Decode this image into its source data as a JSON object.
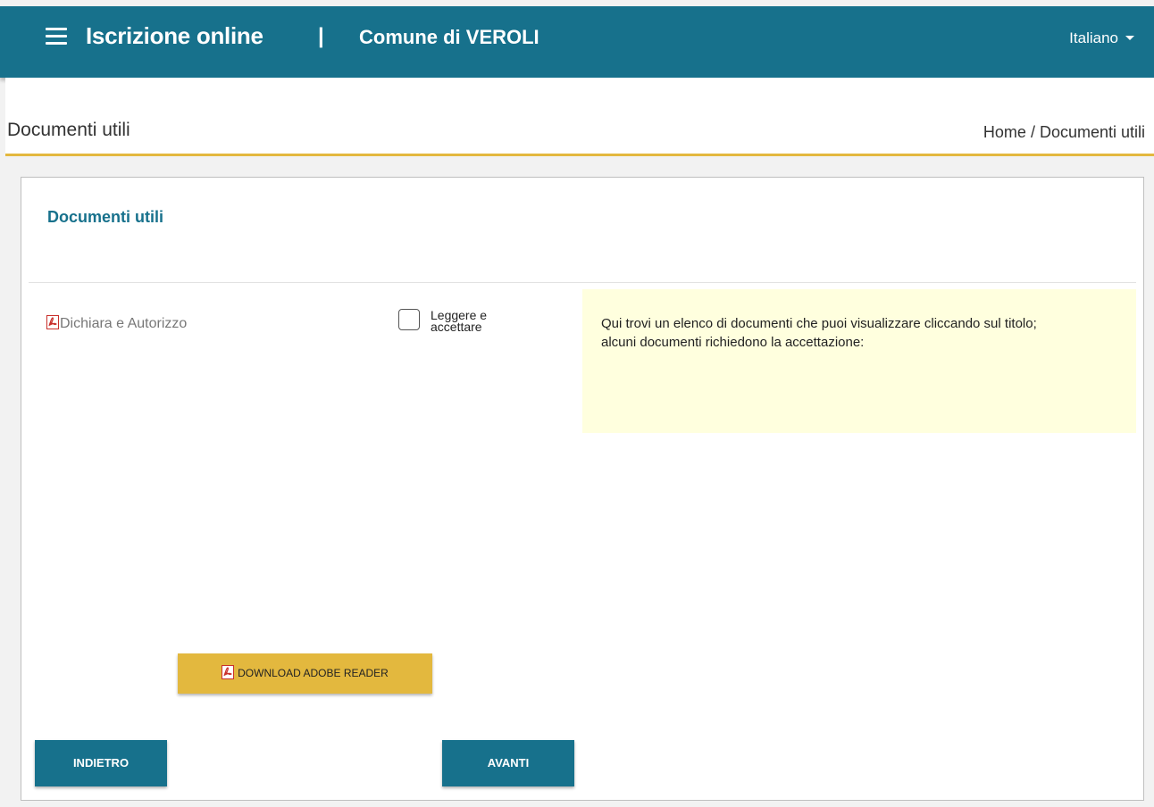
{
  "header": {
    "app_title": "Iscrizione online",
    "separator": "|",
    "comune": "Comune di VEROLI",
    "language": "Italiano",
    "bg_color": "#17718c"
  },
  "page": {
    "title": "Documenti utili",
    "breadcrumb_home": "Home",
    "breadcrumb_sep": " / ",
    "breadcrumb_current": "Documenti utili",
    "accent_color": "#e3b83e"
  },
  "card": {
    "title": "Documenti utili",
    "documents": [
      {
        "icon": "pdf-icon",
        "label": "Dichiara e Autorizzo",
        "accept_label": "Leggere e accettare",
        "accepted": false
      }
    ],
    "info_lines": [
      "Qui trovi un elenco di documenti che puoi visualizzare cliccando sul titolo;",
      "alcuni documenti richiedono la accettazione:"
    ],
    "adobe_button": "DOWNLOAD ADOBE READER",
    "back_button": "INDIETRO",
    "next_button": "AVANTI"
  }
}
